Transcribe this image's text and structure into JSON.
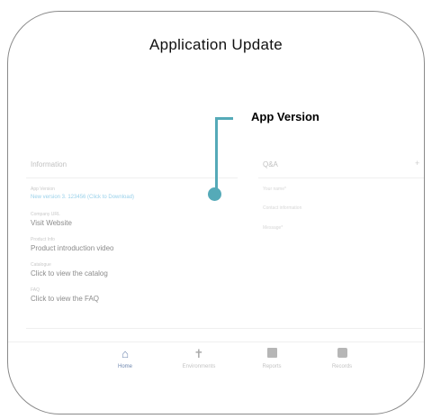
{
  "title": "Application Update",
  "annotation": {
    "label": "App Version"
  },
  "information": {
    "title": "Information",
    "items": [
      {
        "label": "App Version",
        "value": "New version 3. 123456 (Click to Download)",
        "link": true
      },
      {
        "label": "Company URL",
        "value": "Visit Website",
        "link": false
      },
      {
        "label": "Product Info",
        "value": "Product introduction video",
        "link": false
      },
      {
        "label": "Catalogue",
        "value": "Click to view the catalog",
        "link": false
      },
      {
        "label": "FAQ",
        "value": "Click to view the FAQ",
        "link": false
      }
    ]
  },
  "qa": {
    "title": "Q&A",
    "add": "+",
    "fields": [
      "Your name*",
      "Contact information",
      "Message*"
    ]
  },
  "nav": [
    {
      "label": "Home",
      "icon": "home-icon",
      "active": true
    },
    {
      "label": "Environments",
      "icon": "person-icon",
      "active": false
    },
    {
      "label": "Reports",
      "icon": "chart-icon",
      "active": false
    },
    {
      "label": "Records",
      "icon": "document-icon",
      "active": false
    }
  ],
  "colors": {
    "accent": "#55aab8",
    "active_nav": "#133a7c",
    "link": "#5ab4dd"
  }
}
